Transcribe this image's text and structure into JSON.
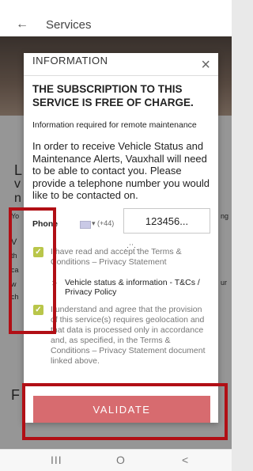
{
  "header": {
    "title": "Services"
  },
  "background_letters": [
    "L",
    "v",
    "n",
    "Yo",
    "V",
    "th",
    "ca",
    "w",
    "ch",
    "ng",
    "ur",
    "F"
  ],
  "modal": {
    "title": "INFORMATION",
    "close_symbol": "×",
    "headline": "THE SUBSCRIPTION TO THIS SERVICE IS FREE OF CHARGE.",
    "sub_label": "Information required for remote maintenance",
    "body": "In order to receive Vehicle Status and Maintenance Alerts, Vauxhall will need to be able to contact you. Please provide a telephone number you would like to be contacted on.",
    "phone": {
      "label": "Phone",
      "country_code": "▾ (+44)",
      "value": "123456..."
    },
    "terms_checkbox": {
      "checked": true,
      "text": "I have read and accept the Terms & Conditions – Privacy Statement"
    },
    "link": {
      "arrow": ">",
      "text": "Vehicle status & information - T&Cs / Privacy Policy"
    },
    "geo_checkbox": {
      "checked": true,
      "text": "I understand and agree that the provision of this service(s) requires geolocation and that data is processed only in accordance and, as specified, in the Terms & Conditions – Privacy Statement document linked above."
    },
    "validate_label": "VALIDATE"
  },
  "navbar": {
    "recents": "III",
    "home": "O",
    "back": "<"
  },
  "colors": {
    "accent_button": "#d76b6f",
    "checkbox": "#b9c64a",
    "highlight": "#b10f15"
  }
}
